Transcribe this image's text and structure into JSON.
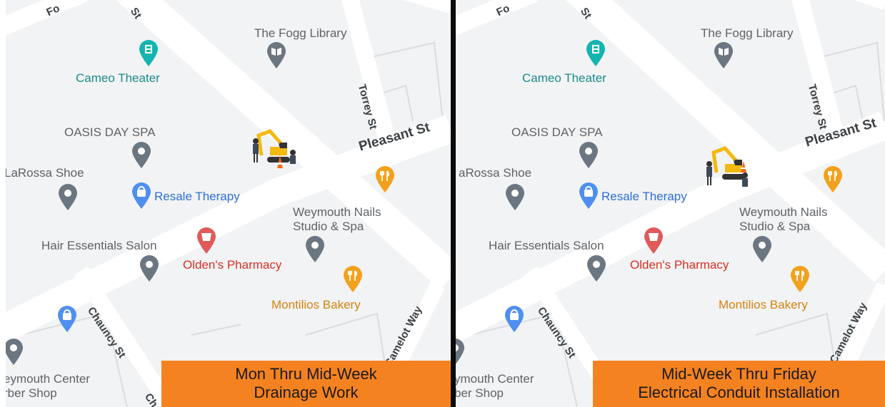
{
  "panels": [
    {
      "banner": {
        "line1": "Mon Thru Mid-Week",
        "line2": "Drainage Work"
      },
      "streets": {
        "pleasant": "Pleasant St",
        "torrey": "Torrey St",
        "chauncy": "Chauncy St",
        "camelot": "Camelot Way",
        "st_top": "St",
        "fo_top": "Fo",
        "ch_bottom": "Ch"
      },
      "places": {
        "fogg": "The Fogg Library",
        "cameo": "Cameo Theater",
        "oasis": "OASIS DAY SPA",
        "larossa": "LaRossa Shoe",
        "resale": "Resale Therapy",
        "nails1": "Weymouth Nails",
        "nails2": "Studio & Spa",
        "hair": "Hair Essentials Salon",
        "olden": "Olden's Pharmacy",
        "montilios": "Montilios Bakery",
        "center1": "eymouth Center",
        "center2": "rber Shop"
      }
    },
    {
      "banner": {
        "line1": "Mid-Week Thru Friday",
        "line2": "Electrical Conduit Installation"
      },
      "streets": {
        "pleasant": "Pleasant St",
        "torrey": "Torrey St",
        "chauncy": "Chauncy St",
        "camelot": "Camelot Way",
        "st_top": "St",
        "fo_top": "Fo"
      },
      "places": {
        "fogg": "The Fogg Library",
        "cameo": "Cameo Theater",
        "oasis": "OASIS DAY SPA",
        "larossa": "aRossa Shoe",
        "resale": "Resale Therapy",
        "nails1": "Weymouth Nails",
        "nails2": "Studio & Spa",
        "hair": "Hair Essentials Salon",
        "olden": "Olden's Pharmacy",
        "montilios": "Montilios Bakery",
        "center1": "ymouth Center",
        "center2": "ber Shop"
      }
    }
  ],
  "colors": {
    "banner": "#f58220",
    "divider": "#0b0b0b",
    "pin_gray": "#6b7680",
    "pin_teal": "#12b5b0",
    "pin_blue": "#4f8ff0",
    "pin_red": "#e05a5a",
    "pin_orange": "#f2a11c"
  }
}
